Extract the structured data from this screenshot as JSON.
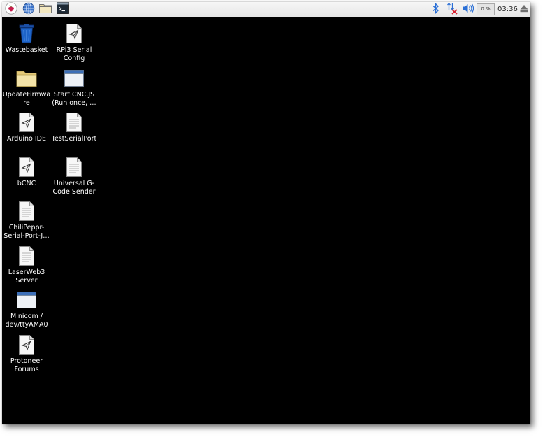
{
  "taskbar": {
    "launchers": [
      {
        "icon": "raspberry-menu-icon"
      },
      {
        "icon": "web-browser-icon"
      },
      {
        "icon": "file-manager-icon"
      },
      {
        "icon": "terminal-icon"
      }
    ],
    "tray": {
      "bluetooth_icon": "bluetooth-icon",
      "network_icon": "network-disconnected-icon",
      "volume_icon": "volume-icon",
      "cpu_usage": "0 %",
      "clock": "03:36",
      "eject_icon": "eject-icon"
    }
  },
  "desktop": {
    "items": [
      {
        "label": "Wastebasket",
        "icon": "wastebasket-icon"
      },
      {
        "label": "RPi3 Serial Config",
        "icon": "shortcut-icon"
      },
      {
        "label": "UpdateFirmware",
        "icon": "folder-icon"
      },
      {
        "label": "Start CNC.JS (Run once, …",
        "icon": "window-app-icon"
      },
      {
        "label": "Arduino IDE",
        "icon": "shortcut-icon"
      },
      {
        "label": "TestSerialPort",
        "icon": "document-icon"
      },
      {
        "label": "bCNC",
        "icon": "shortcut-icon"
      },
      {
        "label": "Universal G-Code Sender",
        "icon": "document-icon"
      },
      {
        "label": "ChiliPeppr-Serial-Port-J…",
        "icon": "document-icon"
      },
      {
        "label": "LaserWeb3 Server",
        "icon": "document-icon"
      },
      {
        "label": "Minicom / dev/ttyAMA0",
        "icon": "window-app-icon"
      },
      {
        "label": "Protoneer Forums",
        "icon": "shortcut-icon"
      }
    ]
  },
  "colors": {
    "desktop_background": "#000000",
    "taskbar_background": "#eeeeee",
    "accent_blue": "#2a6fd6"
  }
}
